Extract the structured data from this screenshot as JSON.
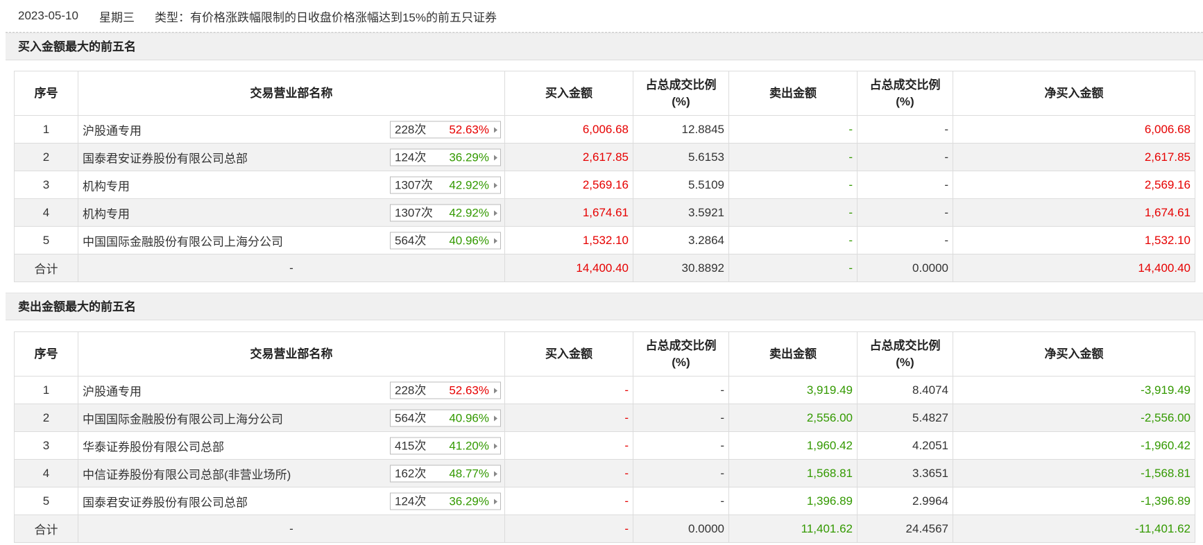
{
  "header": {
    "date": "2023-05-10",
    "weekday": "星期三",
    "type": "类型：有价格涨跌幅限制的日收盘价格涨幅达到15%的前五只证券"
  },
  "columns": {
    "idx": "序号",
    "name": "交易营业部名称",
    "buy": "买入金额",
    "buy_ratio": "占总成交比例\n(%)",
    "sell": "卖出金额",
    "sell_ratio": "占总成交比例\n(%)",
    "net": "净买入金额"
  },
  "colors": {
    "up": "#e60000",
    "down": "#339900"
  },
  "buy_table": {
    "title": "买入金额最大的前五名",
    "rows": [
      {
        "idx": "1",
        "name": "沪股通专用",
        "count": "228次",
        "pct": "52.63%",
        "pct_color": "red",
        "buy": "6,006.68",
        "buy_ratio": "12.8845",
        "sell": "-",
        "sell_ratio": "-",
        "net": "6,006.68"
      },
      {
        "idx": "2",
        "name": "国泰君安证券股份有限公司总部",
        "count": "124次",
        "pct": "36.29%",
        "pct_color": "green",
        "buy": "2,617.85",
        "buy_ratio": "5.6153",
        "sell": "-",
        "sell_ratio": "-",
        "net": "2,617.85"
      },
      {
        "idx": "3",
        "name": "机构专用",
        "count": "1307次",
        "pct": "42.92%",
        "pct_color": "green",
        "buy": "2,569.16",
        "buy_ratio": "5.5109",
        "sell": "-",
        "sell_ratio": "-",
        "net": "2,569.16"
      },
      {
        "idx": "4",
        "name": "机构专用",
        "count": "1307次",
        "pct": "42.92%",
        "pct_color": "green",
        "buy": "1,674.61",
        "buy_ratio": "3.5921",
        "sell": "-",
        "sell_ratio": "-",
        "net": "1,674.61"
      },
      {
        "idx": "5",
        "name": "中国国际金融股份有限公司上海分公司",
        "count": "564次",
        "pct": "40.96%",
        "pct_color": "green",
        "buy": "1,532.10",
        "buy_ratio": "3.2864",
        "sell": "-",
        "sell_ratio": "-",
        "net": "1,532.10"
      }
    ],
    "total": {
      "label": "合计",
      "name": "-",
      "buy": "14,400.40",
      "buy_ratio": "30.8892",
      "sell": "-",
      "sell_ratio": "0.0000",
      "net": "14,400.40"
    }
  },
  "sell_table": {
    "title": "卖出金额最大的前五名",
    "rows": [
      {
        "idx": "1",
        "name": "沪股通专用",
        "count": "228次",
        "pct": "52.63%",
        "pct_color": "red",
        "buy": "-",
        "buy_ratio": "-",
        "sell": "3,919.49",
        "sell_ratio": "8.4074",
        "net": "-3,919.49"
      },
      {
        "idx": "2",
        "name": "中国国际金融股份有限公司上海分公司",
        "count": "564次",
        "pct": "40.96%",
        "pct_color": "green",
        "buy": "-",
        "buy_ratio": "-",
        "sell": "2,556.00",
        "sell_ratio": "5.4827",
        "net": "-2,556.00"
      },
      {
        "idx": "3",
        "name": "华泰证券股份有限公司总部",
        "count": "415次",
        "pct": "41.20%",
        "pct_color": "green",
        "buy": "-",
        "buy_ratio": "-",
        "sell": "1,960.42",
        "sell_ratio": "4.2051",
        "net": "-1,960.42"
      },
      {
        "idx": "4",
        "name": "中信证券股份有限公司总部(非营业场所)",
        "count": "162次",
        "pct": "48.77%",
        "pct_color": "green",
        "buy": "-",
        "buy_ratio": "-",
        "sell": "1,568.81",
        "sell_ratio": "3.3651",
        "net": "-1,568.81"
      },
      {
        "idx": "5",
        "name": "国泰君安证券股份有限公司总部",
        "count": "124次",
        "pct": "36.29%",
        "pct_color": "green",
        "buy": "-",
        "buy_ratio": "-",
        "sell": "1,396.89",
        "sell_ratio": "2.9964",
        "net": "-1,396.89"
      }
    ],
    "total": {
      "label": "合计",
      "name": "-",
      "buy": "-",
      "buy_ratio": "0.0000",
      "sell": "11,401.62",
      "sell_ratio": "24.4567",
      "net": "-11,401.62"
    }
  }
}
